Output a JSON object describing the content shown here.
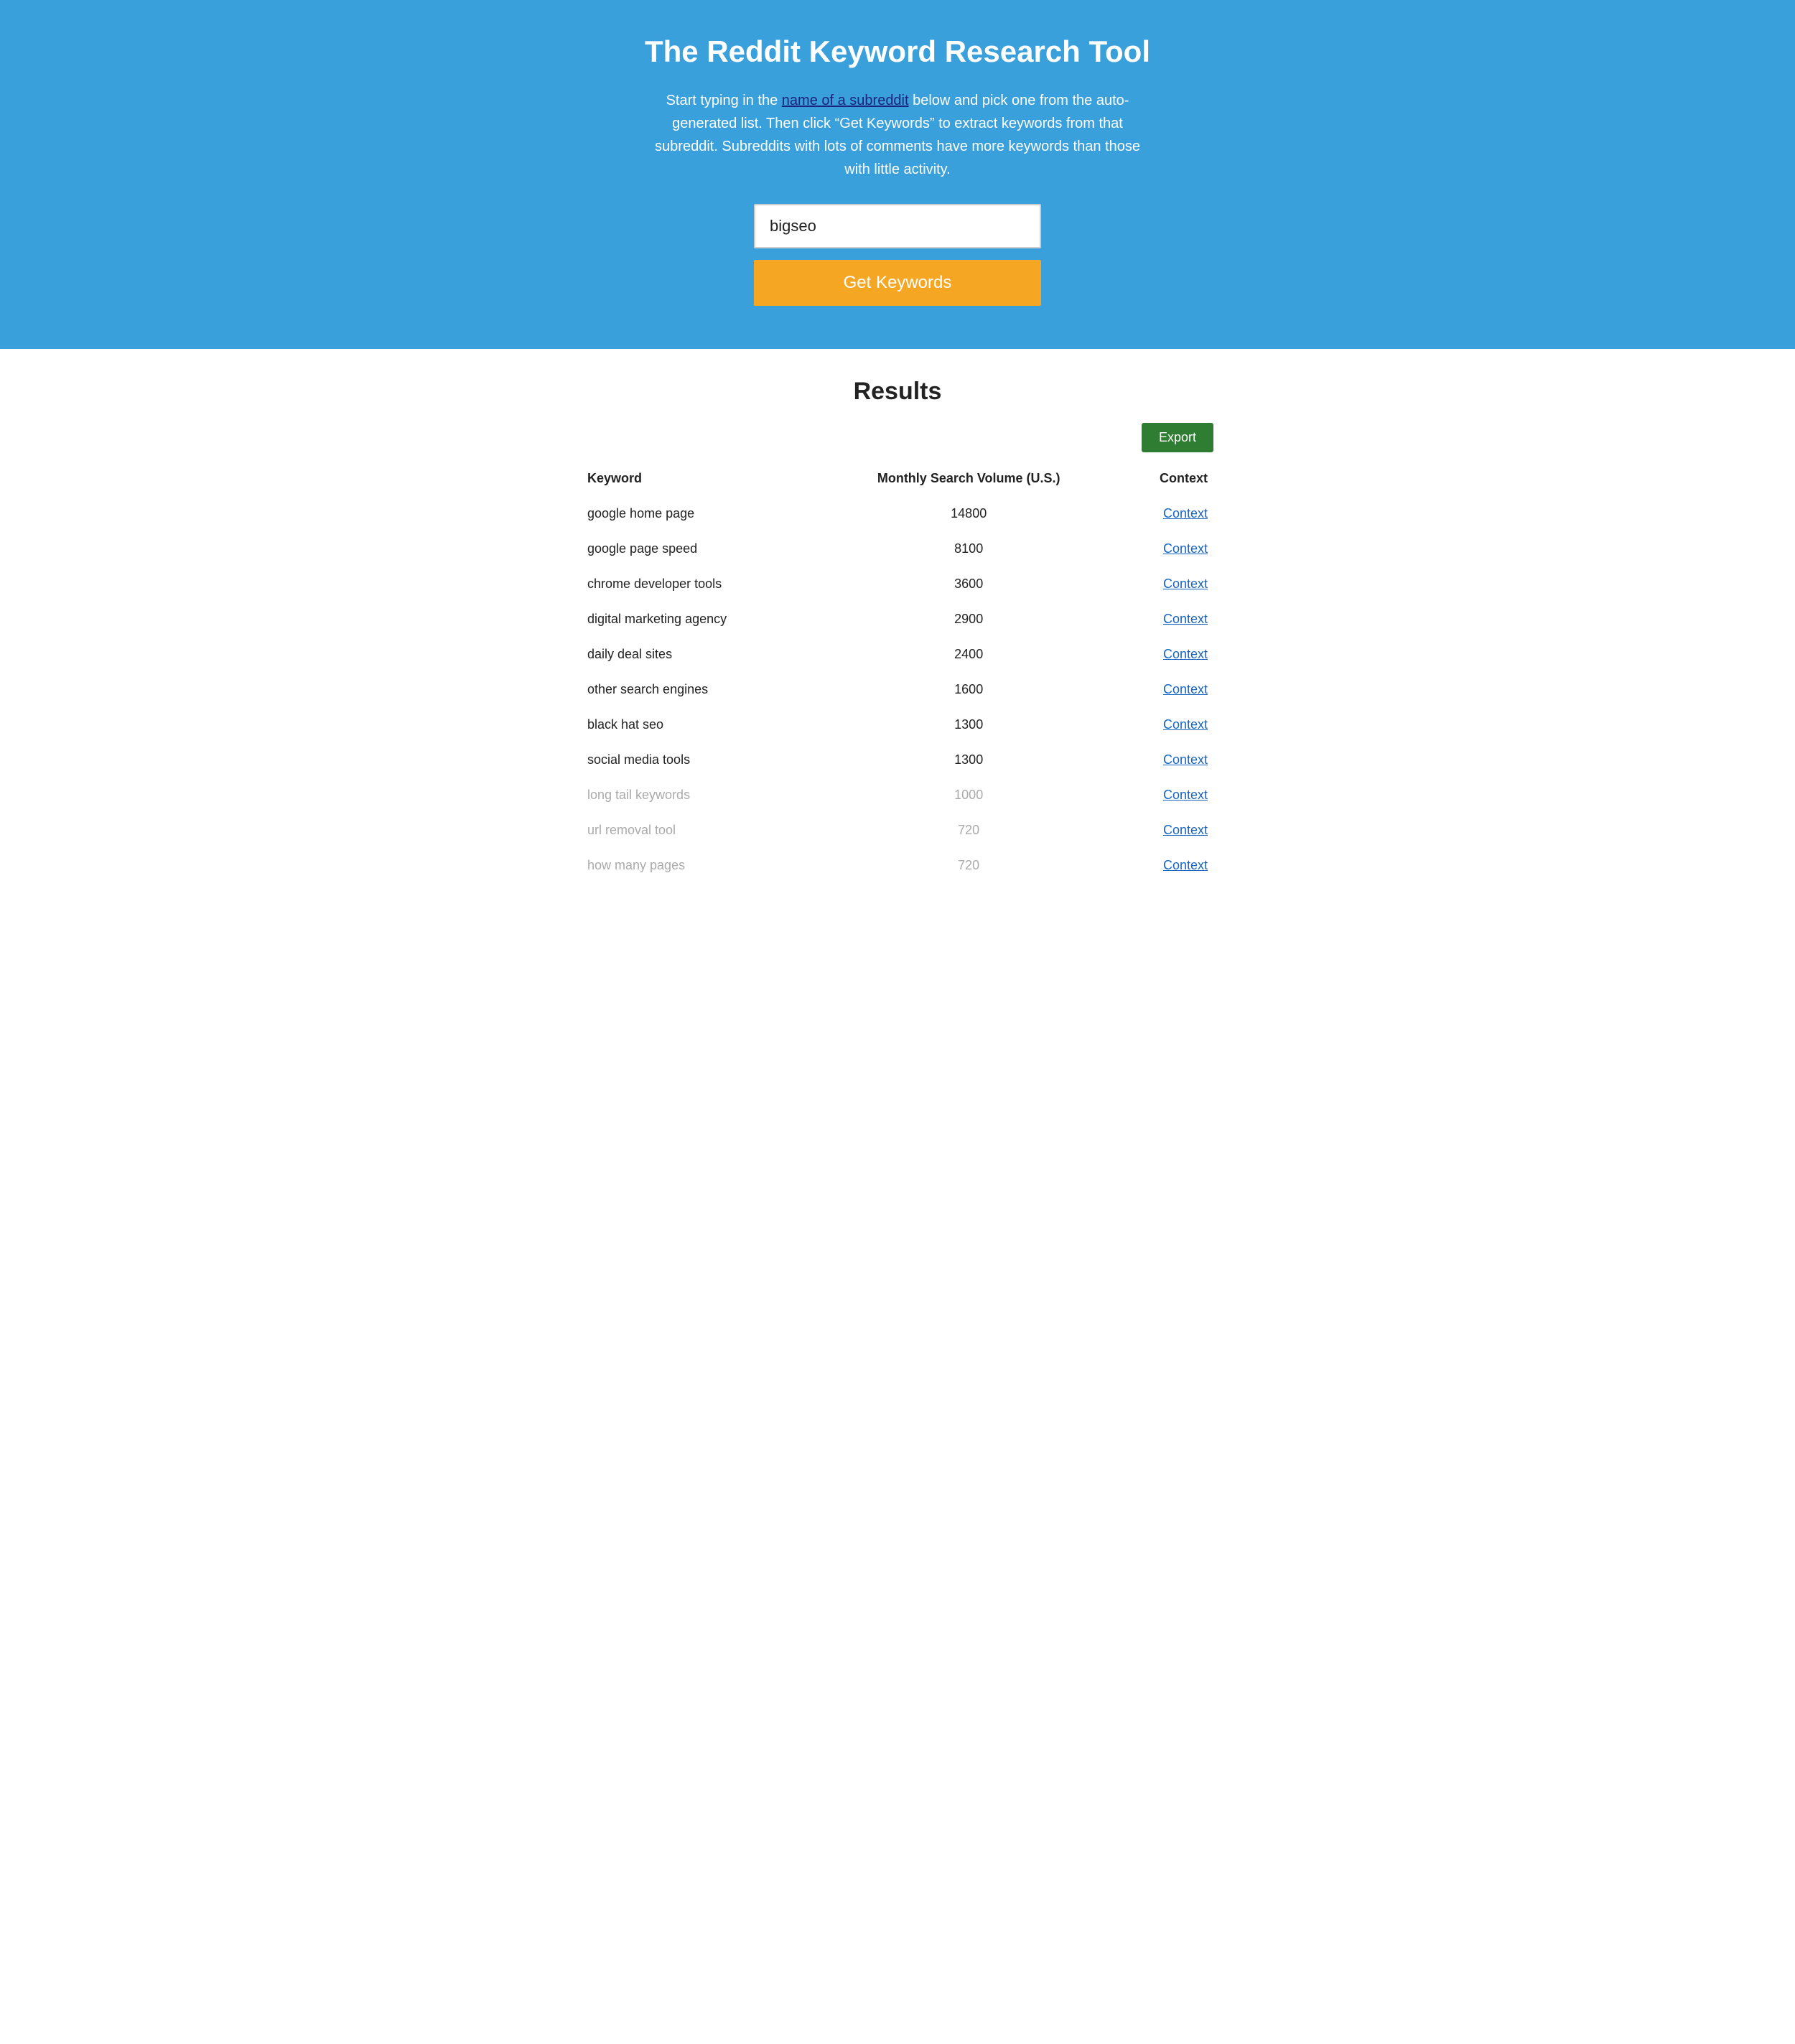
{
  "hero": {
    "title": "The Reddit Keyword Research Tool",
    "description_before": "Start typing in the ",
    "description_link_text": "name of a subreddit",
    "description_after": " below and pick one from the auto-generated list. Then click “Get Keywords” to extract keywords from that subreddit. Subreddits with lots of comments have more keywords than those with little activity.",
    "search_value": "bigseo",
    "search_placeholder": "",
    "button_label": "Get Keywords"
  },
  "results": {
    "title": "Results",
    "export_label": "Export",
    "columns": {
      "keyword": "Keyword",
      "volume": "Monthly Search Volume (U.S.)",
      "context": "Context"
    },
    "rows": [
      {
        "keyword": "google home page",
        "volume": "14800",
        "context": "Context",
        "faded": false
      },
      {
        "keyword": "google page speed",
        "volume": "8100",
        "context": "Context",
        "faded": false
      },
      {
        "keyword": "chrome developer tools",
        "volume": "3600",
        "context": "Context",
        "faded": false
      },
      {
        "keyword": "digital marketing agency",
        "volume": "2900",
        "context": "Context",
        "faded": false
      },
      {
        "keyword": "daily deal sites",
        "volume": "2400",
        "context": "Context",
        "faded": false
      },
      {
        "keyword": "other search engines",
        "volume": "1600",
        "context": "Context",
        "faded": false
      },
      {
        "keyword": "black hat seo",
        "volume": "1300",
        "context": "Context",
        "faded": false
      },
      {
        "keyword": "social media tools",
        "volume": "1300",
        "context": "Context",
        "faded": false
      },
      {
        "keyword": "long tail keywords",
        "volume": "1000",
        "context": "Context",
        "faded": true
      },
      {
        "keyword": "url removal tool",
        "volume": "720",
        "context": "Context",
        "faded": true
      },
      {
        "keyword": "how many pages",
        "volume": "720",
        "context": "Context",
        "faded": true
      }
    ]
  }
}
